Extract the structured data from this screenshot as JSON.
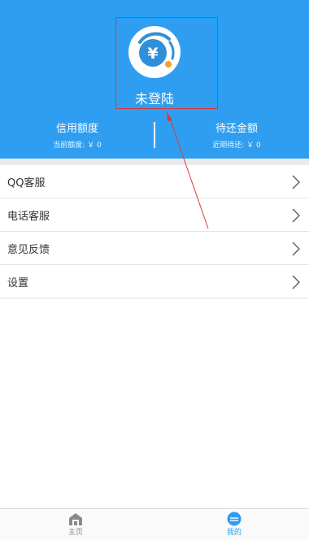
{
  "colors": {
    "header_bg": "#2f9ef0",
    "accent": "#2f9ef0",
    "annotation": "#d93a3a"
  },
  "profile": {
    "logo_icon": "yuan-coin-logo-icon",
    "login_status": "未登陆"
  },
  "stats": {
    "credit": {
      "label": "信用额度",
      "sub": "当前额度: ￥ 0"
    },
    "repay": {
      "label": "待还金额",
      "sub": "近期待还: ￥ 0"
    }
  },
  "menu": {
    "items": [
      {
        "label": "QQ客服",
        "icon": "chevron-right-icon"
      },
      {
        "label": "电话客服",
        "icon": "chevron-right-icon"
      },
      {
        "label": "意见反馈",
        "icon": "chevron-right-icon"
      },
      {
        "label": "设置",
        "icon": "chevron-right-icon"
      }
    ]
  },
  "tabbar": {
    "home": {
      "label": "主页",
      "icon": "home-icon"
    },
    "mine": {
      "label": "我的",
      "icon": "user-avatar-icon"
    }
  }
}
